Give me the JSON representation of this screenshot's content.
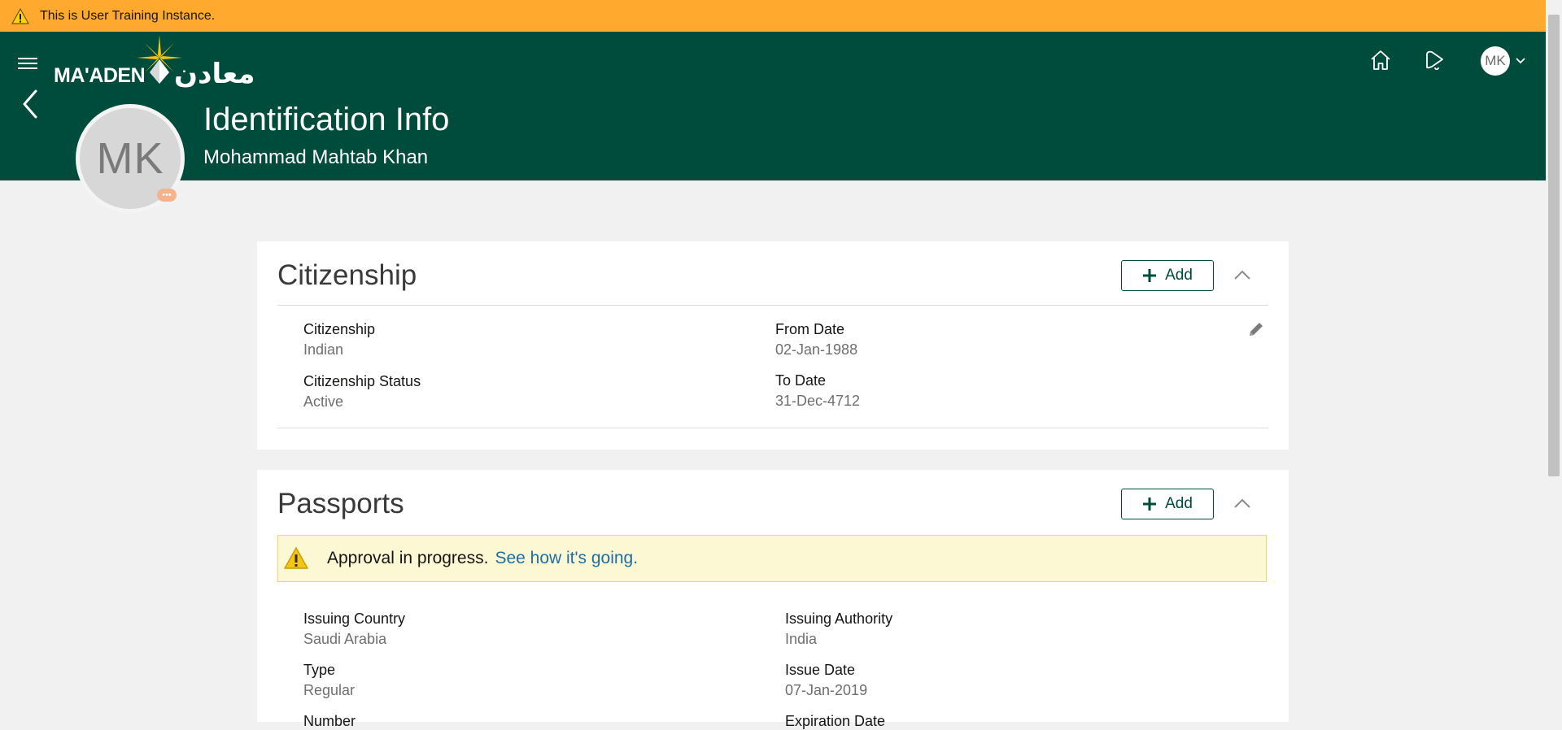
{
  "banner": {
    "text": "This is User Training Instance.",
    "icon": "warning-icon"
  },
  "header": {
    "logo_en": "MA'ADEN",
    "logo_ar": "معادن",
    "home_icon": "home-icon",
    "notifications_icon": "bell-icon",
    "user_initials": "MK"
  },
  "profile": {
    "initials": "MK",
    "status_glyph": "•••",
    "page_title": "Identification Info",
    "person_name": "Mohammad Mahtab Khan"
  },
  "citizenship": {
    "title": "Citizenship",
    "add_label": "Add",
    "fields": {
      "citizenship_label": "Citizenship",
      "citizenship_value": "Indian",
      "status_label": "Citizenship Status",
      "status_value": "Active",
      "from_label": "From Date",
      "from_value": "02-Jan-1988",
      "to_label": "To Date",
      "to_value": "31-Dec-4712"
    }
  },
  "passports": {
    "title": "Passports",
    "add_label": "Add",
    "approval_text": "Approval in progress.",
    "approval_link": "See how it's going.",
    "fields": {
      "country_label": "Issuing Country",
      "country_value": "Saudi Arabia",
      "authority_label": "Issuing Authority",
      "authority_value": "India",
      "type_label": "Type",
      "type_value": "Regular",
      "issue_label": "Issue Date",
      "issue_value": "07-Jan-2019",
      "number_label": "Number",
      "expiration_label": "Expiration Date"
    }
  },
  "colors": {
    "header": "#004c3c",
    "banner": "#ffa92e",
    "link": "#1f6ea3",
    "approval_bg": "#fcf8d4"
  }
}
